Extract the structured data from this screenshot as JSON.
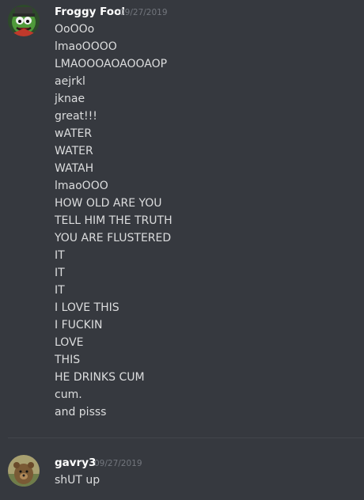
{
  "messages": [
    {
      "author": "Froggy Fool",
      "timestamp": "09/27/2019",
      "avatar_icon": "kermit-frog-avatar-icon",
      "lines": [
        "OoOOo",
        "lmaoOOOO",
        "LMAOOOAOAOOAOP",
        "aejrkl",
        "jknae",
        "great!!!",
        "wATER",
        "WATER",
        "WATAH",
        "lmaoOOO",
        "HOW OLD ARE YOU",
        "TELL HIM THE TRUTH",
        "YOU ARE FLUSTERED",
        "IT",
        "IT",
        "IT",
        "I LOVE THIS",
        "I FUCKIN",
        "LOVE",
        "THIS",
        "HE DRINKS CUM",
        "cum.",
        "and pisss"
      ]
    },
    {
      "author": "gavry3",
      "timestamp": "09/27/2019",
      "avatar_icon": "bear-avatar-icon",
      "lines": [
        "shUT up"
      ]
    }
  ],
  "colors": {
    "background": "#36393f",
    "author": "#ffffff",
    "timestamp": "#72767d",
    "text": "#dcddde",
    "divider": "#43464c"
  }
}
